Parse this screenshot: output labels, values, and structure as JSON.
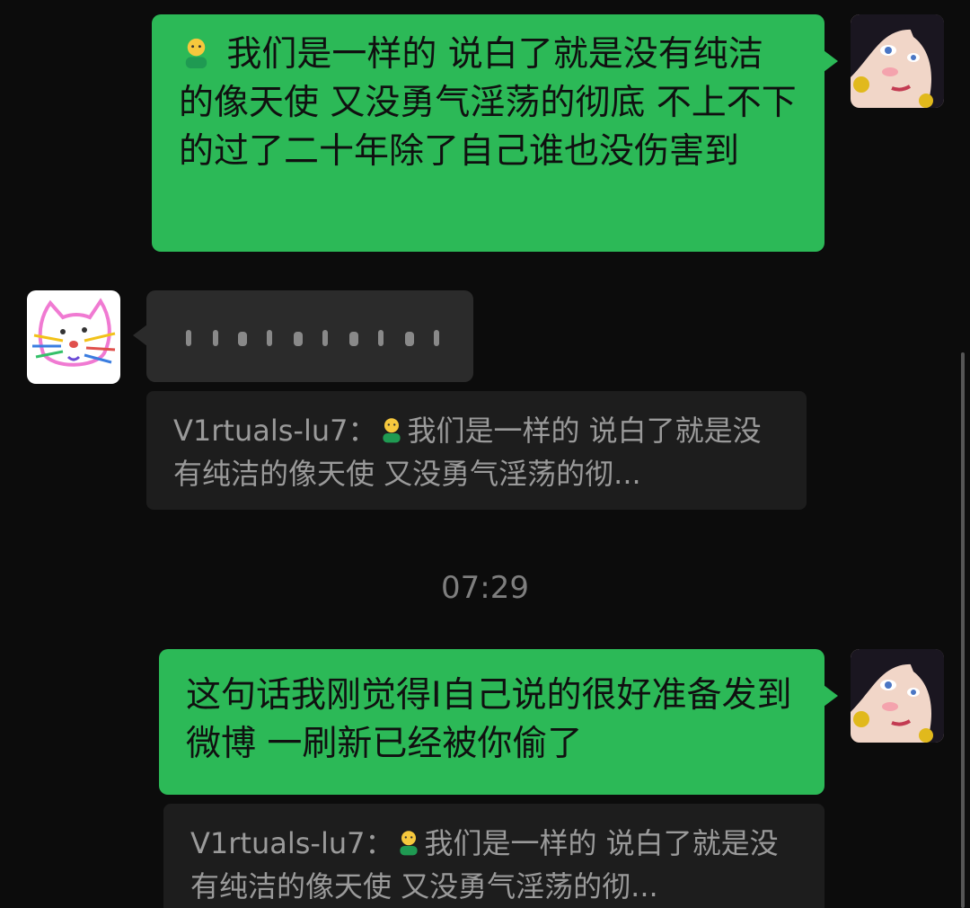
{
  "messages": [
    {
      "id": "m1",
      "side": "right",
      "type": "text",
      "emoji": "person-emoji",
      "text": "我们是一样的 说白了就是没有纯洁的像天使 又没勇气淫荡的彻底  不上不下的过了二十年除了自己谁也没伤害到"
    },
    {
      "id": "m2",
      "side": "left",
      "type": "voice-blurred",
      "quote": {
        "sender": "V1rtuals-lu7",
        "emoji": "person-emoji",
        "text": "我们是一样的 说白了就是没有纯洁的像天使 又没勇气淫荡的彻..."
      }
    },
    {
      "id": "m3",
      "side": "right",
      "type": "text",
      "text": "这句话我刚觉得I自己说的很好准备发到微博 一刷新已经被你偷了",
      "quote": {
        "sender": "V1rtuals-lu7",
        "emoji": "person-emoji",
        "text": "我们是一样的 说白了就是没有纯洁的像天使 又没勇气淫荡的彻..."
      }
    }
  ],
  "timestamp": "07:29",
  "quote_separator": "：",
  "colors": {
    "background": "#0c0c0c",
    "bubble_green": "#2cb957",
    "bubble_dark": "#2b2b2b",
    "quote_bg": "#1d1d1d",
    "quote_text": "#9a9a9a",
    "timestamp_text": "#7e7e7e"
  },
  "icons": {
    "user_avatar": "anime-woman-avatar",
    "contact_avatar": "cat-doodle-avatar"
  }
}
